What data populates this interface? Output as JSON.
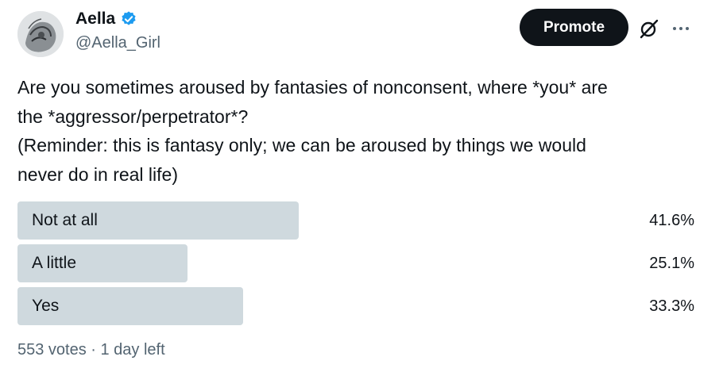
{
  "author": {
    "display_name": "Aella",
    "handle": "@Aella_Girl",
    "verified": true,
    "verified_color": "#1d9bf0"
  },
  "actions": {
    "promote_label": "Promote",
    "grok_icon": "grok-icon",
    "more_icon": "more-icon"
  },
  "tweet": {
    "lines": [
      "Are you sometimes aroused by fantasies of nonconsent, where *you* are",
      "the *aggressor/perpetrator*?",
      "(Reminder: this is fantasy only; we can be aroused by things we would",
      "never do in real life)"
    ]
  },
  "poll": {
    "bar_color": "#cfd9de",
    "options": [
      {
        "label": "Not at all",
        "percent_text": "41.6%",
        "percent": 41.6
      },
      {
        "label": "A little",
        "percent_text": "25.1%",
        "percent": 25.1
      },
      {
        "label": "Yes",
        "percent_text": "33.3%",
        "percent": 33.3
      }
    ],
    "footer": "553 votes · 1 day left"
  }
}
